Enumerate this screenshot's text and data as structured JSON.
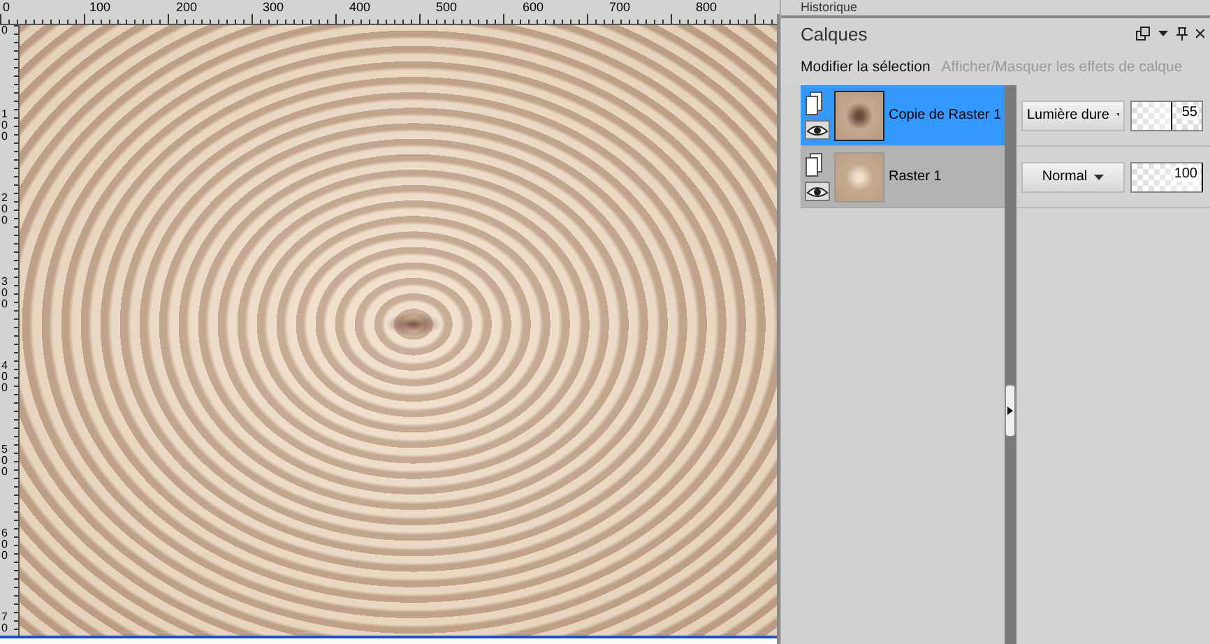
{
  "ruler_top": {
    "labels": [
      "0",
      "100",
      "200",
      "300",
      "400",
      "500",
      "600",
      "700",
      "800"
    ]
  },
  "ruler_left": {
    "labels": [
      "0",
      "100",
      "200",
      "300",
      "400",
      "500",
      "600",
      "70"
    ]
  },
  "history_panel": {
    "title": "Historique"
  },
  "layers_panel": {
    "title": "Calques",
    "toolbar": [
      "Modifier la sélection",
      "Afficher/Masquer les effets de calque"
    ],
    "layers": [
      {
        "name": "Copie de Raster 1",
        "selected": true,
        "visible": true,
        "blend_mode": "Lumière dure",
        "opacity": "55",
        "level": 0.55
      },
      {
        "name": "Raster 1",
        "selected": false,
        "visible": true,
        "blend_mode": "Normal",
        "opacity": "100",
        "level": 1
      }
    ]
  }
}
